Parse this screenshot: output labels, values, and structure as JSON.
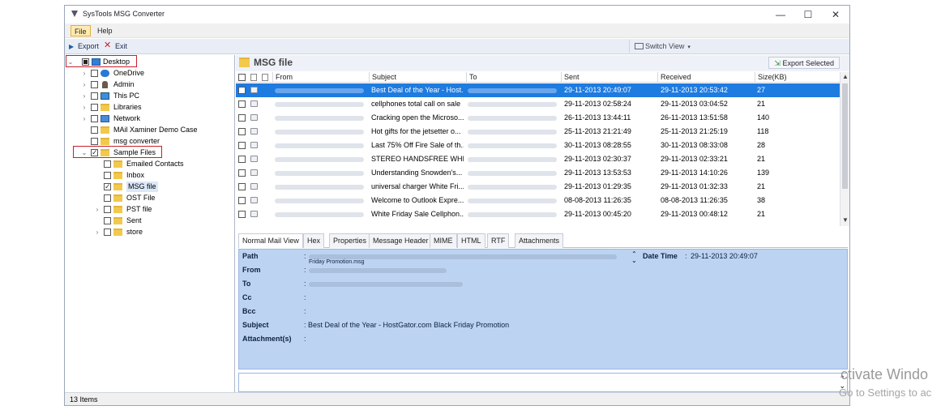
{
  "window": {
    "title": "SysTools MSG Converter",
    "minimize": "—",
    "maximize": "☐",
    "close": "✕"
  },
  "menu": {
    "file": "File",
    "help": "Help"
  },
  "toolbar": {
    "export": "Export",
    "exit": "Exit",
    "switch_view": "Switch View"
  },
  "tree": {
    "desktop": "Desktop",
    "onedrive": "OneDrive",
    "admin": "Admin",
    "this_pc": "This PC",
    "libraries": "Libraries",
    "network": "Network",
    "mail_xaminer": "MAil Xaminer Demo Case",
    "msg_converter": "msg converter",
    "sample_files": "Sample Files",
    "emailed_contacts": "Emailed Contacts",
    "inbox": "Inbox",
    "msg_file": "MSG file",
    "ost_file": "OST File",
    "pst_file": "PST file",
    "sent": "Sent",
    "store": "store"
  },
  "panel": {
    "title": "MSG file",
    "export_selected": "Export Selected"
  },
  "columns": {
    "from": "From",
    "subject": "Subject",
    "to": "To",
    "sent": "Sent",
    "received": "Received",
    "size": "Size(KB)"
  },
  "rows": [
    {
      "subject": "Best Deal of the Year - Host...",
      "sent": "29-11-2013 20:49:07",
      "received": "29-11-2013 20:53:42",
      "size": "27"
    },
    {
      "subject": "cellphones total call on sale",
      "sent": "29-11-2013 02:58:24",
      "received": "29-11-2013 03:04:52",
      "size": "21"
    },
    {
      "subject": "Cracking open the Microso...",
      "sent": "26-11-2013 13:44:11",
      "received": "26-11-2013 13:51:58",
      "size": "140"
    },
    {
      "subject": "Hot gifts for the jetsetter o...",
      "sent": "25-11-2013 21:21:49",
      "received": "25-11-2013 21:25:19",
      "size": "118"
    },
    {
      "subject": "Last 75% Off Fire Sale of th...",
      "sent": "30-11-2013 08:28:55",
      "received": "30-11-2013 08:33:08",
      "size": "28"
    },
    {
      "subject": "STEREO HANDSFREE WHIT...",
      "sent": "29-11-2013 02:30:37",
      "received": "29-11-2013 02:33:21",
      "size": "21"
    },
    {
      "subject": "Understanding Snowden's...",
      "sent": "29-11-2013 13:53:53",
      "received": "29-11-2013 14:10:26",
      "size": "139"
    },
    {
      "subject": "universal charger White Fri...",
      "sent": "29-11-2013 01:29:35",
      "received": "29-11-2013 01:32:33",
      "size": "21"
    },
    {
      "subject": "Welcome to Outlook Expre...",
      "sent": "08-08-2013 11:26:35",
      "received": "08-08-2013 11:26:35",
      "size": "38"
    },
    {
      "subject": "White Friday Sale Cellphon...",
      "sent": "29-11-2013 00:45:20",
      "received": "29-11-2013 00:48:12",
      "size": "21"
    }
  ],
  "tabs": [
    "Normal Mail View",
    "Hex",
    "Properties",
    "Message Header",
    "MIME",
    "HTML",
    "RTF",
    "Attachments"
  ],
  "details": {
    "path_label": "Path",
    "path_tail": "Friday Promotion.msg",
    "from_label": "From",
    "to_label": "To",
    "cc_label": "Cc",
    "bcc_label": "Bcc",
    "subject_label": "Subject",
    "subject_value": ": Best Deal of the Year - HostGator.com Black Friday Promotion",
    "attachments_label": "Attachment(s)",
    "date_label": "Date Time",
    "date_value": "29-11-2013 20:49:07"
  },
  "status": {
    "items": "13 Items"
  },
  "watermark": {
    "line1": "ctivate Windo",
    "line2": "Go to Settings to ac"
  }
}
